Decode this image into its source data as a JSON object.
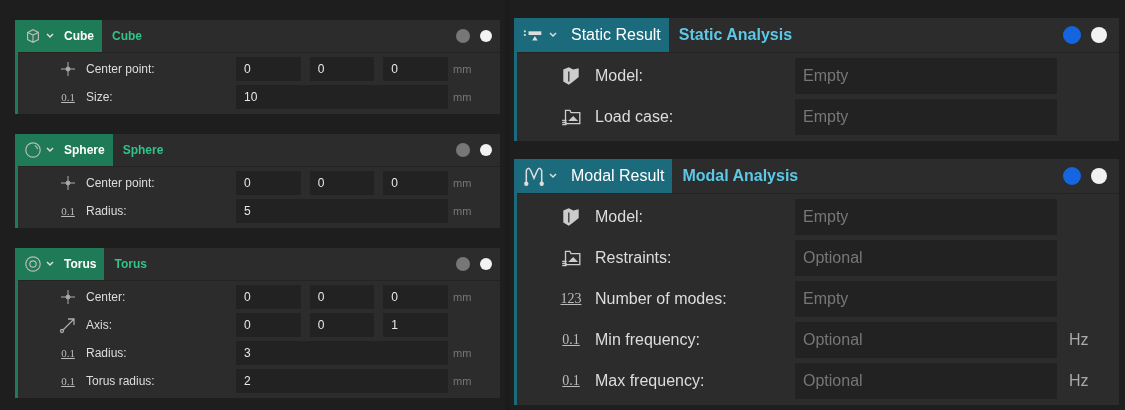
{
  "panels": [
    {
      "nodes": [
        {
          "kind": "cube",
          "title": "Cube",
          "name": "Cube",
          "color": "#1f7a57",
          "expanded": true,
          "help_highlighted": false,
          "params": [
            {
              "kind": "point",
              "label": "Center point:",
              "values": [
                "0",
                "0",
                "0"
              ],
              "unit": "mm"
            },
            {
              "kind": "number",
              "glyph": "0.1",
              "label": "Size:",
              "values": [
                "10"
              ],
              "unit": "mm"
            }
          ]
        },
        {
          "kind": "sphere",
          "title": "Sphere",
          "name": "Sphere",
          "color": "#1f7a57",
          "expanded": true,
          "help_highlighted": false,
          "params": [
            {
              "kind": "point",
              "label": "Center point:",
              "values": [
                "0",
                "0",
                "0"
              ],
              "unit": "mm"
            },
            {
              "kind": "number",
              "glyph": "0.1",
              "label": "Radius:",
              "values": [
                "5"
              ],
              "unit": "mm"
            }
          ]
        },
        {
          "kind": "torus",
          "title": "Torus",
          "name": "Torus",
          "color": "#1f7a57",
          "expanded": true,
          "help_highlighted": false,
          "params": [
            {
              "kind": "point",
              "label": "Center:",
              "values": [
                "0",
                "0",
                "0"
              ],
              "unit": "mm"
            },
            {
              "kind": "vector",
              "label": "Axis:",
              "values": [
                "0",
                "0",
                "1"
              ]
            },
            {
              "kind": "number",
              "glyph": "0.1",
              "label": "Radius:",
              "values": [
                "3"
              ],
              "unit": "mm"
            },
            {
              "kind": "number",
              "glyph": "0.1",
              "label": "Torus radius:",
              "values": [
                "2"
              ],
              "unit": "mm"
            }
          ]
        }
      ]
    },
    {
      "nodes": [
        {
          "kind": "static",
          "title": "Static Result",
          "name": "Static Analysis",
          "color": "#1b6b7d",
          "expanded": true,
          "help_highlighted": true,
          "params": [
            {
              "kind": "model",
              "label": "Model:",
              "placeholder": "Empty"
            },
            {
              "kind": "load",
              "label": "Load case:",
              "placeholder": "Empty"
            }
          ]
        },
        {
          "kind": "modal",
          "title": "Modal Result",
          "name": "Modal Analysis",
          "color": "#1b6b7d",
          "expanded": true,
          "help_highlighted": true,
          "params": [
            {
              "kind": "model",
              "label": "Model:",
              "placeholder": "Empty"
            },
            {
              "kind": "load",
              "label": "Restraints:",
              "placeholder": "Optional"
            },
            {
              "kind": "number",
              "glyph": "123",
              "label": "Number of modes:",
              "placeholder": "Empty"
            },
            {
              "kind": "number",
              "glyph": "0.1",
              "label": "Min frequency:",
              "placeholder": "Optional",
              "unit": "Hz"
            },
            {
              "kind": "number",
              "glyph": "0.1",
              "label": "Max frequency:",
              "placeholder": "Optional",
              "unit": "Hz"
            }
          ]
        }
      ]
    }
  ]
}
